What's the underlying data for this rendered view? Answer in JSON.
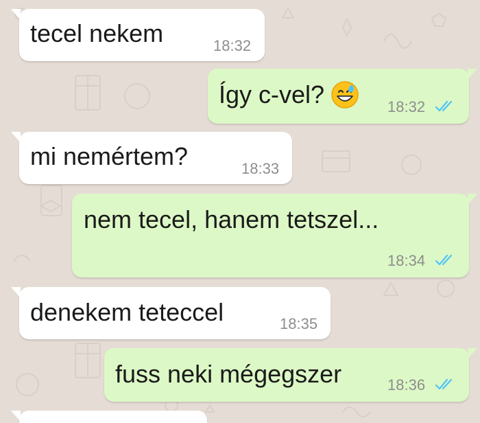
{
  "conversation": {
    "messages": [
      {
        "direction": "incoming",
        "text": "tecel nekem",
        "time": "18:32"
      },
      {
        "direction": "outgoing",
        "text": "Így c-vel?",
        "emoji": "grinning-face-with-sweat-emoji",
        "time": "18:32",
        "status": "read"
      },
      {
        "direction": "incoming",
        "text": "mi nemértem?",
        "time": "18:33"
      },
      {
        "direction": "outgoing",
        "text": "nem tecel, hanem tetszel...",
        "time": "18:34",
        "status": "read"
      },
      {
        "direction": "incoming",
        "text": "denekem teteccel",
        "time": "18:35"
      },
      {
        "direction": "outgoing",
        "text": "fuss neki mégegszer",
        "time": "18:36",
        "status": "read"
      }
    ]
  },
  "colors": {
    "background": "#e5ddd5",
    "incoming_bubble": "#ffffff",
    "outgoing_bubble": "#dcf8c6",
    "read_ticks": "#4fc3f7",
    "timestamp": "#8d8d8d"
  }
}
